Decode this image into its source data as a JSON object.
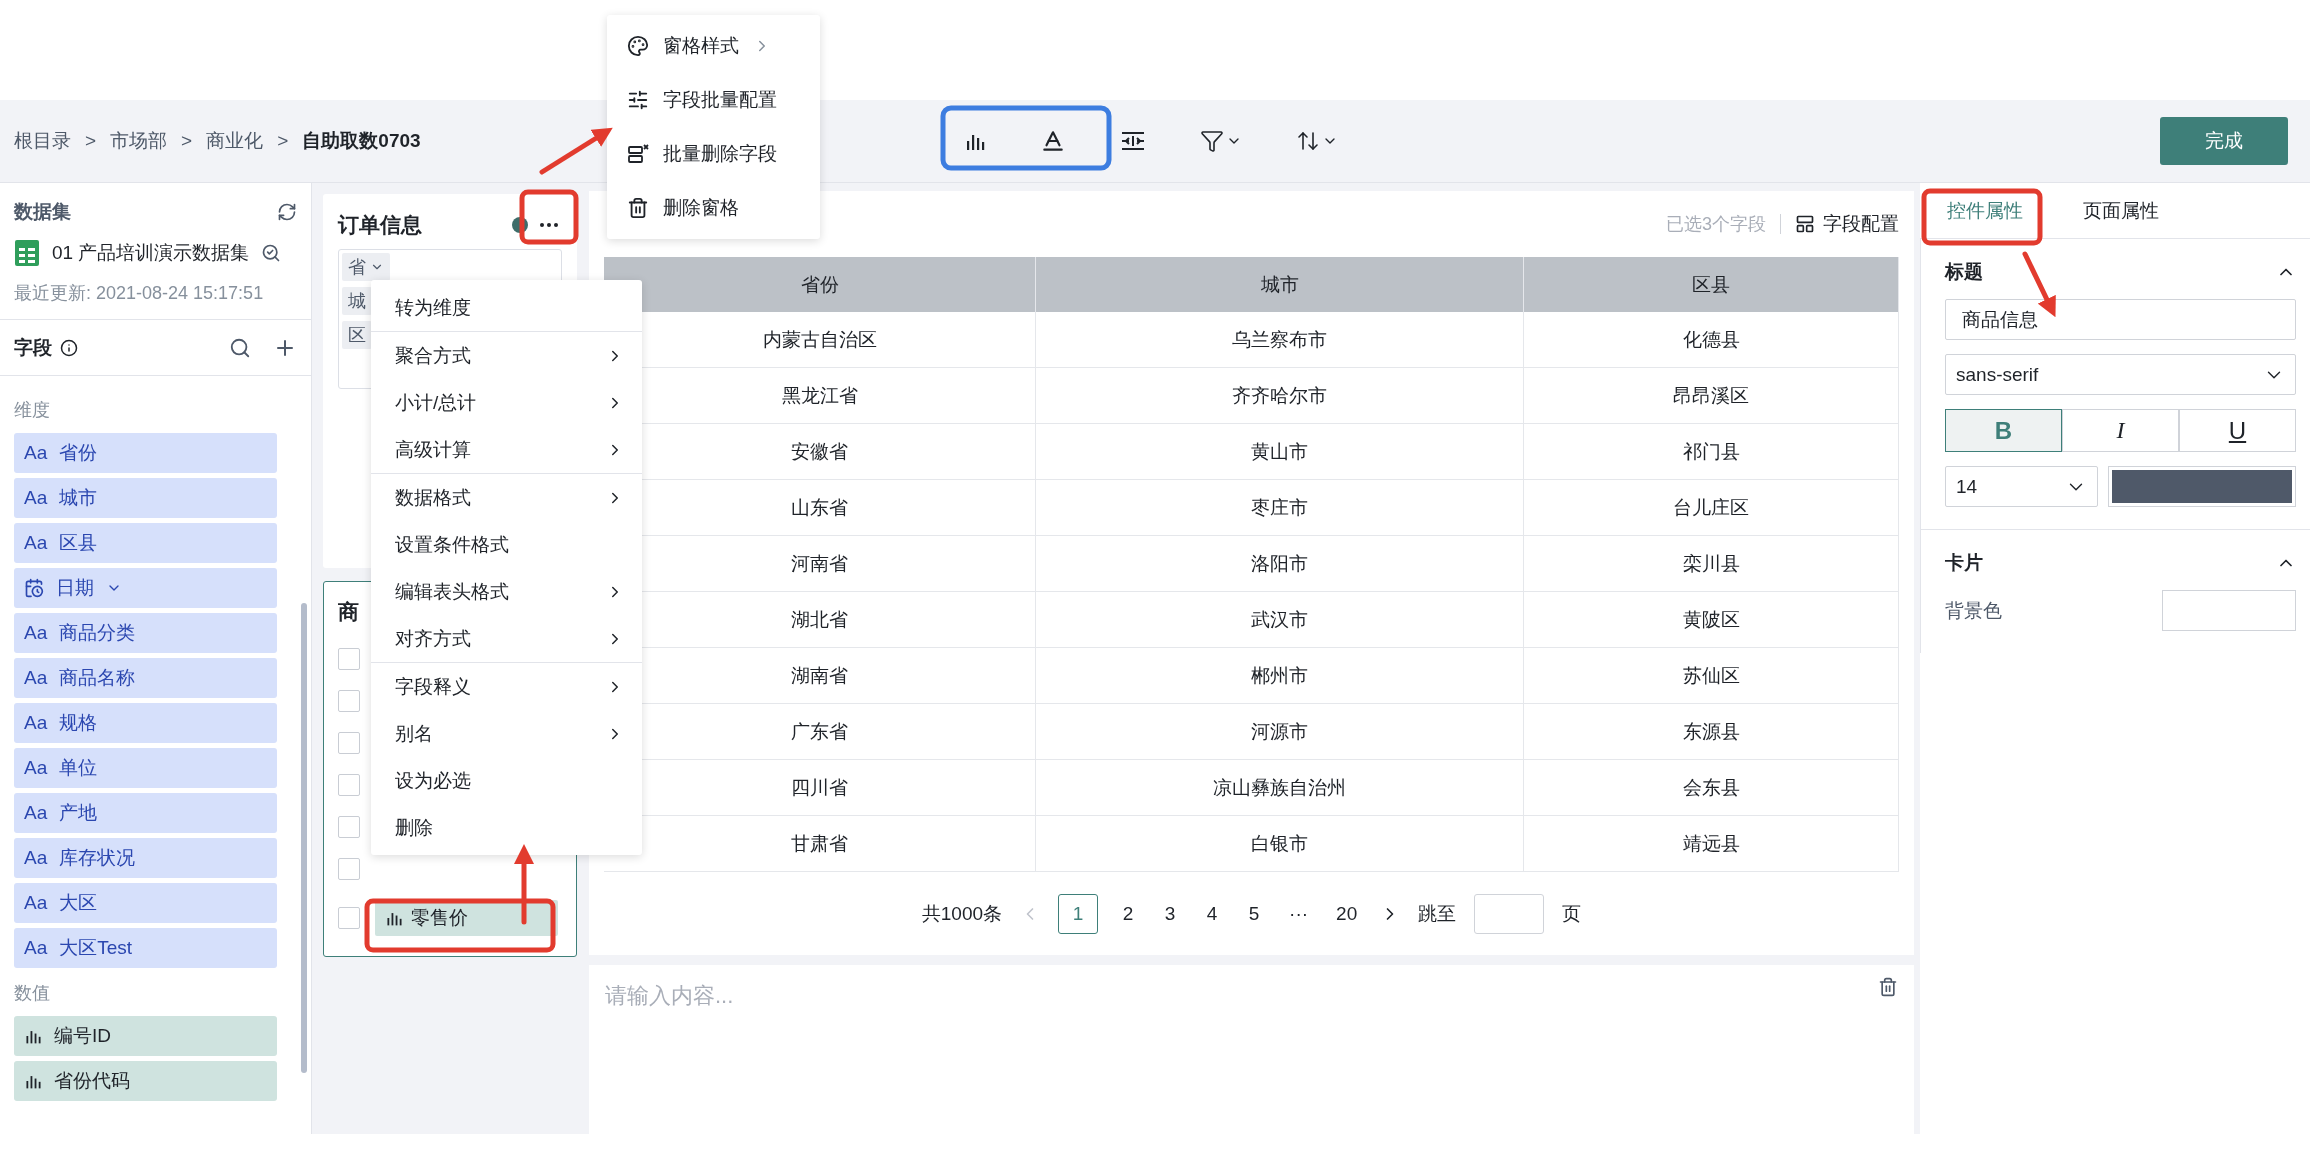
{
  "breadcrumb": [
    {
      "kind": "link",
      "text": "根目录"
    },
    {
      "kind": "sep",
      "text": ">"
    },
    {
      "kind": "link",
      "text": "市场部"
    },
    {
      "kind": "sep",
      "text": ">"
    },
    {
      "kind": "link",
      "text": "商业化"
    },
    {
      "kind": "sep",
      "text": ">"
    },
    {
      "kind": "current",
      "text": "自助取数0703"
    }
  ],
  "done_button": "完成",
  "sidebar": {
    "dataset_title": "数据集",
    "dataset_name": "01 产品培训演示数据集",
    "updated": "最近更新: 2021-08-24 15:17:51",
    "fields_title": "字段",
    "groups": [
      {
        "title": "维度",
        "items": [
          {
            "kind": "text",
            "prefix": "Aa",
            "label": "省份"
          },
          {
            "kind": "text",
            "prefix": "Aa",
            "label": "城市"
          },
          {
            "kind": "text",
            "prefix": "Aa",
            "label": "区县"
          },
          {
            "kind": "date",
            "label": "日期"
          },
          {
            "kind": "text",
            "prefix": "Aa",
            "label": "商品分类"
          },
          {
            "kind": "text",
            "prefix": "Aa",
            "label": "商品名称"
          },
          {
            "kind": "text",
            "prefix": "Aa",
            "label": "规格"
          },
          {
            "kind": "text",
            "prefix": "Aa",
            "label": "单位"
          },
          {
            "kind": "text",
            "prefix": "Aa",
            "label": "产地"
          },
          {
            "kind": "text",
            "prefix": "Aa",
            "label": "库存状况"
          },
          {
            "kind": "text",
            "prefix": "Aa",
            "label": "大区"
          },
          {
            "kind": "text",
            "prefix": "Aa",
            "label": "大区Test"
          }
        ]
      },
      {
        "title": "数值",
        "items": [
          {
            "kind": "number",
            "label": "编号ID"
          },
          {
            "kind": "number",
            "label": "省份代码"
          }
        ]
      }
    ]
  },
  "filter_panels": [
    {
      "title": "订单信息",
      "selected": false,
      "chips": [
        "省",
        "城",
        "区"
      ]
    },
    {
      "title": "商",
      "selected": true,
      "rows": [
        {
          "checked": false
        },
        {
          "checked": false
        },
        {
          "checked": false
        },
        {
          "checked": false
        },
        {
          "checked": false
        },
        {
          "checked": false
        },
        {
          "checked": false,
          "label": "零售价"
        }
      ]
    }
  ],
  "pane_menu": [
    {
      "label": "窗格样式",
      "submenu": true
    },
    {
      "label": "字段批量配置",
      "submenu": false
    },
    {
      "label": "批量删除字段",
      "submenu": false
    },
    {
      "label": "删除窗格",
      "submenu": false
    }
  ],
  "context_menu": [
    [
      {
        "label": "转为维度",
        "submenu": false
      }
    ],
    [
      {
        "label": "聚合方式",
        "submenu": true
      },
      {
        "label": "小计/总计",
        "submenu": true
      },
      {
        "label": "高级计算",
        "submenu": true
      }
    ],
    [
      {
        "label": "数据格式",
        "submenu": true
      },
      {
        "label": "设置条件格式",
        "submenu": false
      },
      {
        "label": "编辑表头格式",
        "submenu": true
      },
      {
        "label": "对齐方式",
        "submenu": true
      }
    ],
    [
      {
        "label": "字段释义",
        "submenu": true
      },
      {
        "label": "别名",
        "submenu": true
      },
      {
        "label": "设为必选",
        "submenu": false
      },
      {
        "label": "删除",
        "submenu": false
      }
    ]
  ],
  "table": {
    "selected_info": "已选3个字段",
    "config_button": "字段配置",
    "columns": [
      "省份",
      "城市",
      "区县"
    ],
    "rows": [
      [
        "内蒙古自治区",
        "乌兰察布市",
        "化德县"
      ],
      [
        "黑龙江省",
        "齐齐哈尔市",
        "昂昂溪区"
      ],
      [
        "安徽省",
        "黄山市",
        "祁门县"
      ],
      [
        "山东省",
        "枣庄市",
        "台儿庄区"
      ],
      [
        "河南省",
        "洛阳市",
        "栾川县"
      ],
      [
        "湖北省",
        "武汉市",
        "黄陂区"
      ],
      [
        "湖南省",
        "郴州市",
        "苏仙区"
      ],
      [
        "广东省",
        "河源市",
        "东源县"
      ],
      [
        "四川省",
        "凉山彝族自治州",
        "会东县"
      ],
      [
        "甘肃省",
        "白银市",
        "靖远县"
      ]
    ],
    "pagination": {
      "total": "共1000条",
      "pages": [
        {
          "label": "1",
          "selected": true
        },
        {
          "label": "2",
          "selected": false
        },
        {
          "label": "3",
          "selected": false
        },
        {
          "label": "4",
          "selected": false
        },
        {
          "label": "5",
          "selected": false
        },
        {
          "label": "···",
          "selected": false
        },
        {
          "label": "20",
          "selected": false
        }
      ],
      "jump_label": "跳至",
      "page_unit": "页"
    }
  },
  "text_card": {
    "placeholder": "请输入内容..."
  },
  "right_panel": {
    "tabs": [
      {
        "label": "控件属性",
        "selected": true
      },
      {
        "label": "页面属性",
        "selected": false
      }
    ],
    "sections": [
      {
        "kind": "title",
        "title": "标题",
        "expanded": true,
        "value": "商品信息",
        "font": "sans-serif",
        "styles": [
          {
            "label": "B",
            "selected": true
          },
          {
            "label": "I",
            "selected": false
          },
          {
            "label": "U",
            "selected": false
          }
        ],
        "size": "14",
        "color": "#4f5969"
      },
      {
        "kind": "card",
        "title": "卡片",
        "expanded": true,
        "bg_label": "背景色"
      }
    ]
  }
}
